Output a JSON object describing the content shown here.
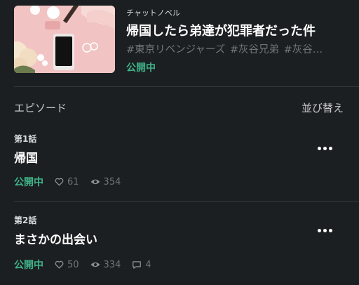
{
  "novel": {
    "genre": "チャットノベル",
    "title": "帰国したら弟達が犯罪者だった件",
    "tags": [
      "#東京リベンジャーズ",
      "#灰谷兄弟",
      "#灰谷…"
    ],
    "status": "公開中"
  },
  "episodes_section": {
    "label": "エピソード",
    "sort_label": "並び替え"
  },
  "episodes": [
    {
      "number": "第1話",
      "title": "帰国",
      "status": "公開中",
      "likes": "61",
      "views": "354"
    },
    {
      "number": "第2話",
      "title": "まさかの出会い",
      "status": "公開中",
      "likes": "50",
      "views": "334",
      "comments": "4"
    }
  ],
  "colors": {
    "background": "#1c1f21",
    "accent_green": "#3eb489",
    "muted_text": "#6f767a"
  }
}
